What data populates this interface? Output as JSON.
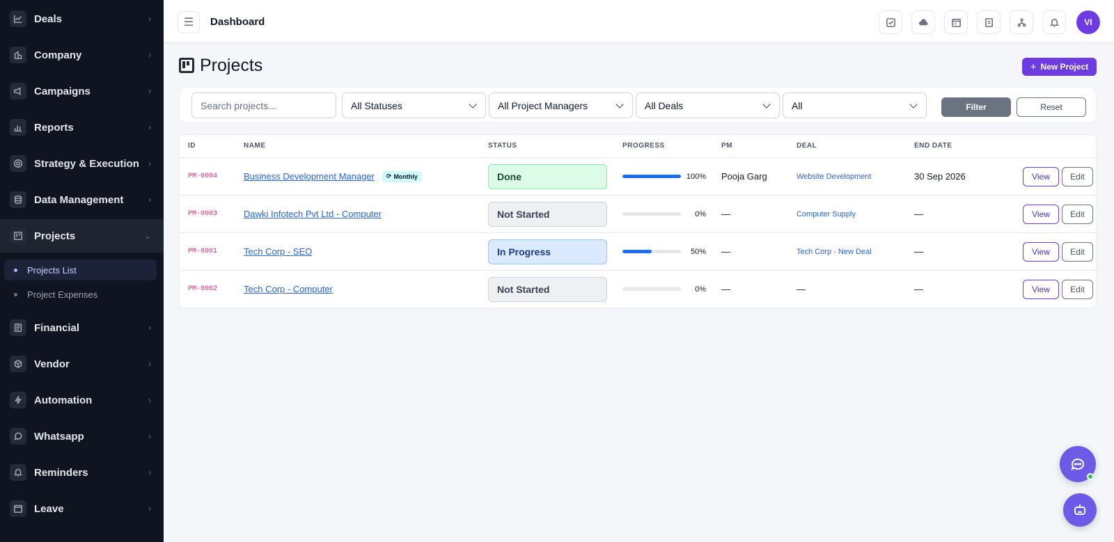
{
  "sidebar": {
    "items": [
      {
        "label": "Deals",
        "icon": "chart-line-icon"
      },
      {
        "label": "Company",
        "icon": "building-icon"
      },
      {
        "label": "Campaigns",
        "icon": "megaphone-icon"
      },
      {
        "label": "Reports",
        "icon": "bar-chart-icon"
      },
      {
        "label": "Strategy & Execution",
        "icon": "target-icon"
      },
      {
        "label": "Data Management",
        "icon": "database-icon"
      },
      {
        "label": "Projects",
        "icon": "kanban-icon"
      },
      {
        "label": "Financial",
        "icon": "ledger-icon"
      },
      {
        "label": "Vendor",
        "icon": "box-icon"
      },
      {
        "label": "Automation",
        "icon": "bolt-icon"
      },
      {
        "label": "Whatsapp",
        "icon": "whatsapp-icon"
      },
      {
        "label": "Reminders",
        "icon": "bell-icon"
      },
      {
        "label": "Leave",
        "icon": "calendar-icon"
      }
    ],
    "projects_sub": [
      {
        "label": "Projects List"
      },
      {
        "label": "Project Expenses"
      }
    ]
  },
  "header": {
    "title": "Dashboard",
    "avatar_initials": "VI",
    "icons": [
      "task-check-icon",
      "cloud-icon",
      "calendar-window-icon",
      "clipboard-icon",
      "org-chart-icon",
      "bell-icon"
    ]
  },
  "page": {
    "title": "Projects",
    "new_button": "New Project"
  },
  "filters": {
    "search_placeholder": "Search projects...",
    "status": "All Statuses",
    "managers": "All Project Managers",
    "deals": "All Deals",
    "other": "All",
    "filter_btn": "Filter",
    "reset_btn": "Reset"
  },
  "table": {
    "columns": [
      "ID",
      "NAME",
      "STATUS",
      "PROGRESS",
      "PM",
      "DEAL",
      "END DATE"
    ],
    "rows": [
      {
        "id": "PM-0004",
        "name": "Business Development Manager",
        "badge": "Monthly",
        "status": "Done",
        "status_kind": "done",
        "progress": 100,
        "progress_label": "100%",
        "pm": "Pooja Garg",
        "deal": "Website Development",
        "end_date": "30 Sep 2026",
        "view": "View",
        "edit": "Edit"
      },
      {
        "id": "PM-0003",
        "name": "Dawki Infotech Pvt Ltd - Computer",
        "badge": "",
        "status": "Not Started",
        "status_kind": "ns",
        "progress": 0,
        "progress_label": "0%",
        "pm": "—",
        "deal": "Computer Supply",
        "end_date": "—",
        "view": "View",
        "edit": "Edit"
      },
      {
        "id": "PM-0001",
        "name": "Tech Corp - SEO",
        "badge": "",
        "status": "In Progress",
        "status_kind": "ip",
        "progress": 50,
        "progress_label": "50%",
        "pm": "—",
        "deal": "Tech Corp - New Deal",
        "end_date": "—",
        "view": "View",
        "edit": "Edit"
      },
      {
        "id": "PM-0002",
        "name": "Tech Corp - Computer",
        "badge": "",
        "status": "Not Started",
        "status_kind": "ns",
        "progress": 0,
        "progress_label": "0%",
        "pm": "—",
        "deal": "—",
        "end_date": "—",
        "view": "View",
        "edit": "Edit"
      }
    ]
  },
  "colors": {
    "accent": "#6d3be0",
    "sidebar_bg": "#0f1420",
    "link": "#2563eb",
    "progress": "#1d6ff2"
  }
}
